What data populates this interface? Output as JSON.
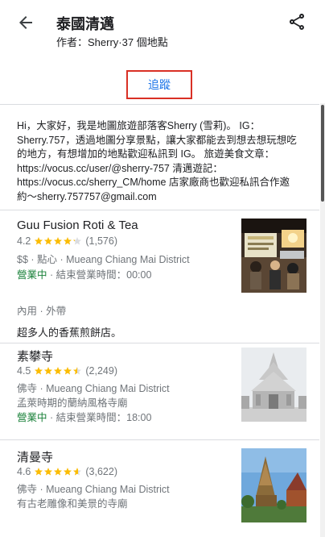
{
  "header": {
    "title": "泰國清邁",
    "subtitle": "作者：Sherry·37 個地點"
  },
  "follow_label": "追蹤",
  "intro_text": "Hi，大家好，我是地圖旅遊部落客Sherry (雪莉)。 IG：Sherry.757，透過地圖分享景點，讓大家都能去到想去想玩想吃的地方，有想增加的地點歡迎私訊到 IG。 旅遊美食文章：https://vocus.cc/user/@sherry-757 清邁遊記：https://vocus.cc/sherry_CM/home 店家廠商也歡迎私訊合作邀約〜sherry.757757@gmail.com",
  "places": [
    {
      "name": "Guu Fusion Roti & Tea",
      "rating": "4.2",
      "stars": 4.2,
      "reviews": "(1,576)",
      "meta": "$$ · 點心 · Mueang Chiang Mai District",
      "status": "營業中",
      "hours": " · 結束營業時間：00:00",
      "services": "內用 · 外帶",
      "note": "超多人的香蕉煎餅店。"
    },
    {
      "name": "素攀寺",
      "rating": "4.5",
      "stars": 4.5,
      "reviews": "(2,249)",
      "meta": "佛寺 · Mueang Chiang Mai District",
      "desc": "孟萊時期的蘭納風格寺廟",
      "status": "營業中",
      "hours": " · 結束營業時間：18:00"
    },
    {
      "name": "清曼寺",
      "rating": "4.6",
      "stars": 4.6,
      "reviews": "(3,622)",
      "meta": "佛寺 · Mueang Chiang Mai District",
      "desc": "有古老雕像和美景的寺廟"
    }
  ],
  "colors": {
    "star": "#fbbc04",
    "open": "#188038",
    "link": "#1a73e8",
    "highlight_box": "#d93025"
  }
}
